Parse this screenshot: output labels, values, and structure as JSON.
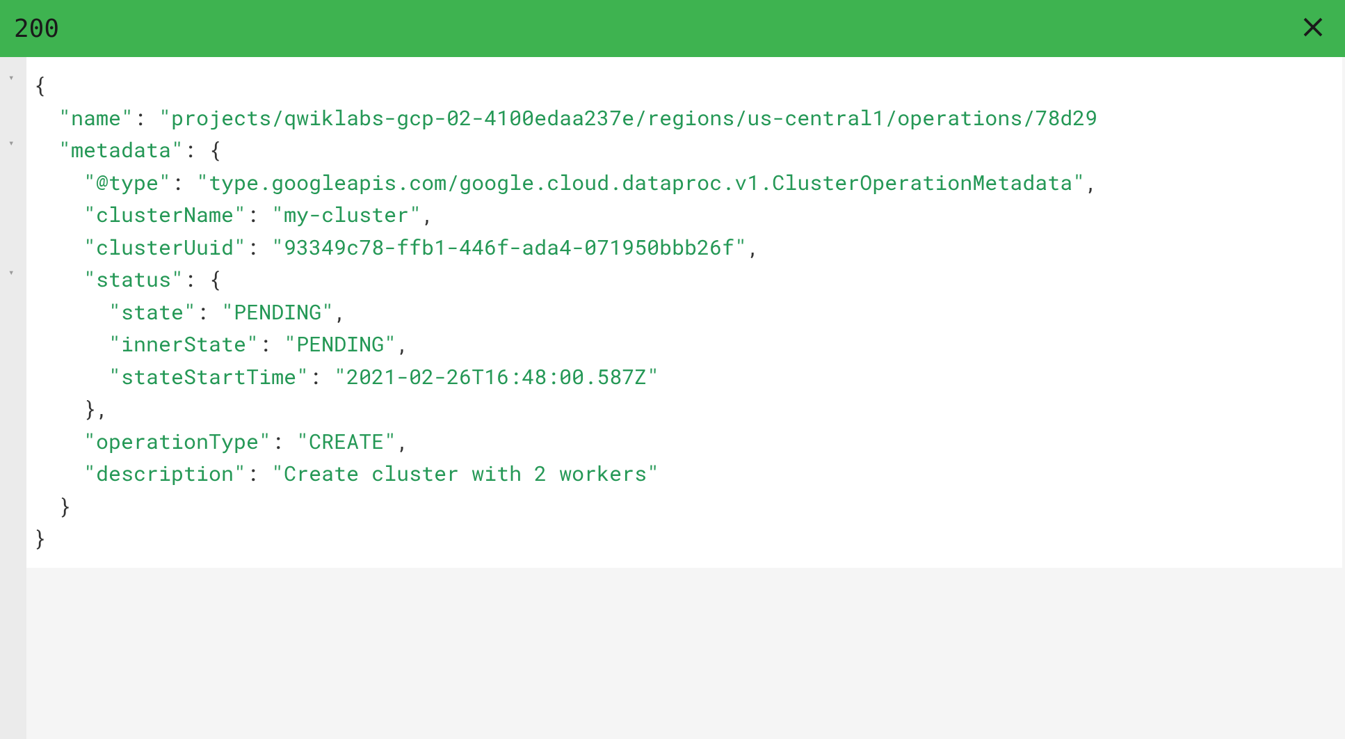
{
  "header": {
    "status": "200"
  },
  "response": {
    "name_key": "\"name\"",
    "name_value": "\"projects/qwiklabs-gcp-02-4100edaa237e/regions/us-central1/operations/78d29",
    "metadata_key": "\"metadata\"",
    "type_key": "\"@type\"",
    "type_value": "\"type.googleapis.com/google.cloud.dataproc.v1.ClusterOperationMetadata\"",
    "clusterName_key": "\"clusterName\"",
    "clusterName_value": "\"my-cluster\"",
    "clusterUuid_key": "\"clusterUuid\"",
    "clusterUuid_value": "\"93349c78-ffb1-446f-ada4-071950bbb26f\"",
    "status_key": "\"status\"",
    "state_key": "\"state\"",
    "state_value": "\"PENDING\"",
    "innerState_key": "\"innerState\"",
    "innerState_value": "\"PENDING\"",
    "stateStartTime_key": "\"stateStartTime\"",
    "stateStartTime_value": "\"2021-02-26T16:48:00.587Z\"",
    "operationType_key": "\"operationType\"",
    "operationType_value": "\"CREATE\"",
    "description_key": "\"description\"",
    "description_value": "\"Create cluster with 2 workers\""
  },
  "fold_glyph": "▾"
}
